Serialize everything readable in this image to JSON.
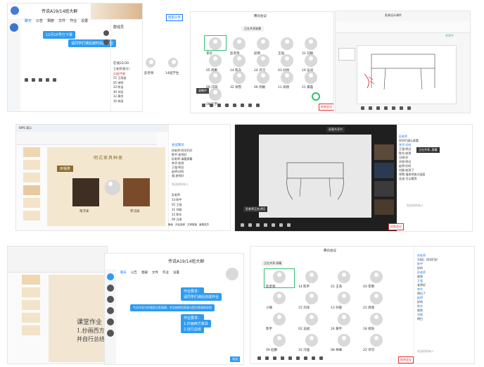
{
  "panel1": {
    "title": "传说A19/14班大群",
    "tabs": [
      "聊天",
      "公告",
      "相册",
      "文件",
      "作业",
      "设置"
    ],
    "session_label": "会议",
    "msg_top": "11月10号已下课",
    "msg_bottom": "请同学们课后按时完成作业",
    "right_title": "群成员",
    "member_count": "在线22/39",
    "members": [
      "王老师(群主)",
      "33赵宇豪",
      "52 王雨涵",
      "05 李明",
      "33 陈浩",
      "40 刘佳",
      "12 周杰",
      "30 林涛"
    ],
    "speaker1": "彭老师",
    "speaker2": "14班学生",
    "share_btn": "结束分享"
  },
  "panel2": {
    "window_title": "腾讯会议",
    "meeting_banner": "正在共享屏幕",
    "host_label": "彭老师",
    "participants": [
      "李华",
      "彭老师",
      "赵明",
      "王强",
      "31 刘颖",
      "05 周鹏",
      "14 陈东",
      "24 许洁",
      "03 孙悦",
      "19 吴迪",
      "09 冯琪",
      "32 郑雪",
      "06 何敏",
      "11 高杨",
      "21 黄磊",
      "08 江宇"
    ],
    "chat_btn": "聊天",
    "end_btn": "结束会议",
    "rec": "录制中"
  },
  "panel3": {
    "title": "家具设计课件",
    "status": "共享中"
  },
  "panel4": {
    "app": "WPS 演示",
    "slide_title": "明式家具种类",
    "slide_section": "床榻类",
    "label_left": "架子床",
    "label_right": "罗汉床",
    "thumbs": [
      "1",
      "2",
      "3",
      "4",
      "5",
      "6"
    ],
    "chat_header": "会议聊天",
    "chat_lines": [
      "徐老师:同学们好",
      "陈宇:老师好",
      "彭老师:请看屏幕",
      "李华:收到",
      "王强:明白",
      "赵明:好的",
      "我:老师好"
    ],
    "chat_input_placeholder": "发送给所有人",
    "members": [
      "彭老师",
      "14 陈宇",
      "05 王强",
      "31 刘颖",
      "22 陈东",
      "09 冯琪"
    ],
    "bottom_bar": [
      "静音",
      "开启视频",
      "共享屏幕",
      "管理成员",
      "聊天",
      "录制",
      "结束"
    ]
  },
  "panel5": {
    "title": "屏幕共享中",
    "caption": "彭老师正在讲话",
    "video_labels": [
      "彭老师",
      "李华",
      "王强",
      "陈东"
    ],
    "chat_lines": [
      "彭老师",
      "同学们请认真看",
      "李华:好的",
      "王强:明白",
      "陈东:收到",
      "冯琪:好",
      "孙悦:明白",
      "赵明:好的",
      "刘颖:收到了",
      "郑雪:请老师放大画面",
      "吴迪:可以看到"
    ],
    "popup": "正在共享, 屏幕",
    "input_placeholder": "发送给所有人",
    "end_btn": "结束会议"
  },
  "panel6": {
    "title": "课堂作业",
    "line1": "1.抄画西方家",
    "line2": "并自行总结出",
    "chat_title": "传说A19/14班大群",
    "tabs": [
      "聊天",
      "公告",
      "相册",
      "文件",
      "作业",
      "设置"
    ],
    "bubbles": [
      "作业要求：",
      "请同学们课后完成作业",
      "今天作业为抄画西方家具图，并总结明式家具与西方家具的异同",
      "作业要求：",
      "1.抄画西方家具",
      "2.自行总结"
    ],
    "send_btn": "发送"
  },
  "panel7": {
    "title": "腾讯会议",
    "banner": "正在共享 屏幕",
    "participants": [
      "彭老师",
      "14 陈宇",
      "22 王浩",
      "03 李明",
      "小微",
      "15 刘洋",
      "13 孙俊",
      "22 周丽",
      "陈宇",
      "02 吴斌",
      "24 黄平",
      "18 郑浩",
      "09 赵鹏",
      "32 冯强",
      "08 林峰",
      "22 许可"
    ],
    "chat_lines": [
      "徐老师",
      "14班：同学们好",
      "陈宇",
      "好的",
      "彭老师",
      "收到",
      "王强",
      "老师好",
      "李华",
      "明白了",
      "赵明",
      "好的",
      "陈东",
      "收到",
      "刘颖",
      "明白"
    ],
    "input_placeholder": "发送给所有人",
    "end_btn": "结束会议"
  }
}
